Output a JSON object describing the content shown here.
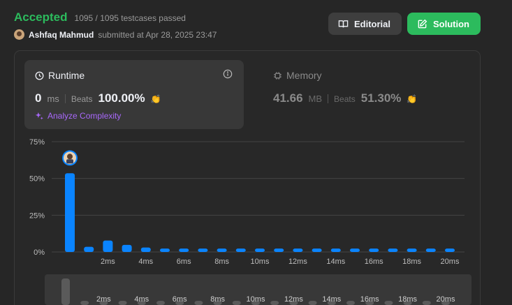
{
  "header": {
    "status": "Accepted",
    "testcases": "1095 / 1095 testcases passed",
    "user": "Ashfaq Mahmud",
    "submitted_at": "submitted at Apr 28, 2025 23:47"
  },
  "buttons": {
    "editorial": "Editorial",
    "solution": "Solution"
  },
  "runtime": {
    "title": "Runtime",
    "value": "0",
    "unit": "ms",
    "beats_label": "Beats",
    "beats": "100.00%",
    "analyze": "Analyze Complexity"
  },
  "memory": {
    "title": "Memory",
    "value": "41.66",
    "unit": "MB",
    "beats_label": "Beats",
    "beats": "51.30%"
  },
  "colors": {
    "accepted": "#2cbb5d",
    "bar": "#0a84ff",
    "analyze": "#a868fa"
  },
  "chart_data": {
    "type": "bar",
    "ylim": [
      0,
      75
    ],
    "yticks": [
      "0%",
      "25%",
      "50%",
      "75%"
    ],
    "ytick_values": [
      0,
      25,
      50,
      75
    ],
    "xticks": [
      "2ms",
      "4ms",
      "6ms",
      "8ms",
      "10ms",
      "12ms",
      "14ms",
      "16ms",
      "18ms",
      "20ms"
    ],
    "values": [
      53.5,
      3.5,
      7.8,
      4.8,
      3.0,
      2.3,
      2.3,
      2.3,
      2.3,
      2.3,
      2.3,
      2.3,
      2.3,
      2.3,
      2.3,
      2.3,
      2.3,
      2.3,
      2.3,
      2.3,
      2.3
    ],
    "highlight_index": 0
  }
}
